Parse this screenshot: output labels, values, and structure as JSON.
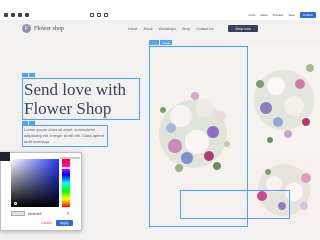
{
  "toolbar": {
    "right_items": [
      "Undo",
      "Redo",
      "Preview",
      "Save"
    ],
    "publish_label": "Publish"
  },
  "site": {
    "logo_letter": "F",
    "logo_text": "Flower shop",
    "nav": [
      "Home",
      "About",
      "Workshops",
      "Shop",
      "Contact Us"
    ],
    "cta_label": "Shop now"
  },
  "hero": {
    "heading_line1": "Send love with",
    "heading_line2": "Flower Shop",
    "paragraph": "Lorem ipsum dolor sit amet, consectetur adipiscing elit. Integer at elit elit. Class aptent taciti sociosqu."
  },
  "image_frame": {
    "tag_label": "Image"
  },
  "color_picker": {
    "hex_value": "#e4e4e4",
    "cancel_label": "Cancel",
    "apply_label": "Apply"
  },
  "colors": {
    "accent": "#4aa3ff",
    "brand": "#3a405d",
    "publish": "#2d6cdf"
  }
}
